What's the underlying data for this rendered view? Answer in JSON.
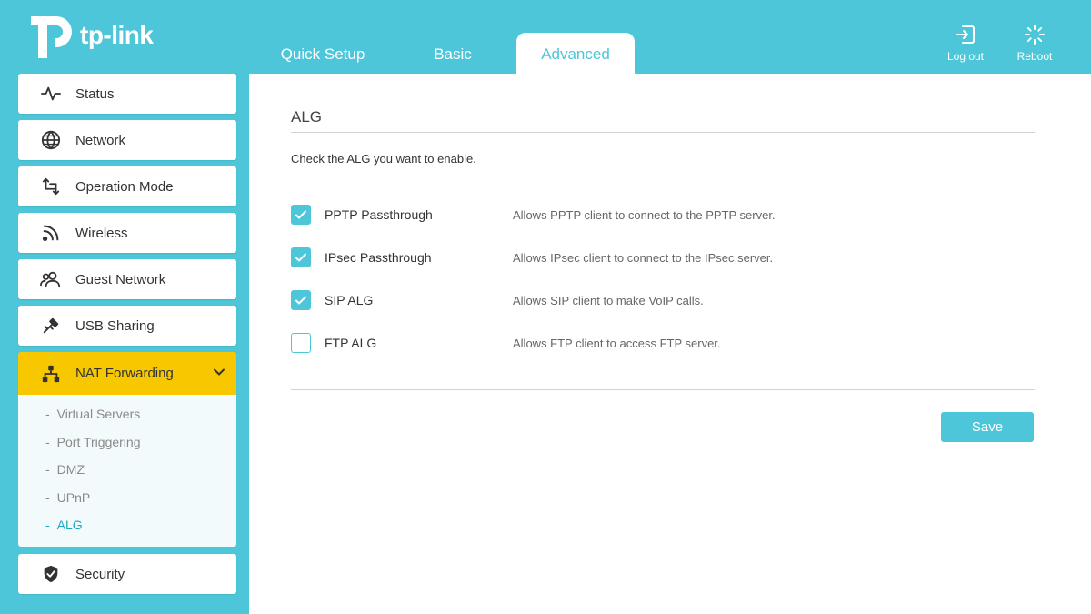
{
  "brand": {
    "name": "tp-link"
  },
  "tabs": [
    {
      "label": "Quick Setup"
    },
    {
      "label": "Basic"
    },
    {
      "label": "Advanced",
      "active": true
    }
  ],
  "top_actions": {
    "logout": {
      "label": "Log out",
      "icon": "logout-icon"
    },
    "reboot": {
      "label": "Reboot",
      "icon": "reboot-icon"
    }
  },
  "sidebar": {
    "items": [
      {
        "label": "Status",
        "icon": "pulse-icon"
      },
      {
        "label": "Network",
        "icon": "globe-icon"
      },
      {
        "label": "Operation Mode",
        "icon": "swap-icon"
      },
      {
        "label": "Wireless",
        "icon": "wifi-icon"
      },
      {
        "label": "Guest Network",
        "icon": "guests-icon"
      },
      {
        "label": "USB Sharing",
        "icon": "usb-icon"
      },
      {
        "label": "NAT Forwarding",
        "icon": "network-tree-icon",
        "active": true,
        "expanded": true
      },
      {
        "label": "Security",
        "icon": "shield-icon"
      }
    ],
    "nat_submenu": [
      {
        "label": "Virtual Servers"
      },
      {
        "label": "Port Triggering"
      },
      {
        "label": "DMZ"
      },
      {
        "label": "UPnP"
      },
      {
        "label": "ALG",
        "active": true
      }
    ]
  },
  "main": {
    "title": "ALG",
    "intro": "Check the ALG you want to enable.",
    "rows": [
      {
        "name": "PPTP Passthrough",
        "checked": true,
        "desc": "Allows PPTP client to connect to the PPTP server."
      },
      {
        "name": "IPsec Passthrough",
        "checked": true,
        "desc": "Allows IPsec client to connect to the IPsec server."
      },
      {
        "name": "SIP ALG",
        "checked": true,
        "desc": "Allows SIP client to make VoIP calls."
      },
      {
        "name": "FTP ALG",
        "checked": false,
        "desc": "Allows FTP client to access FTP server."
      }
    ],
    "save_label": "Save"
  },
  "colors": {
    "brand": "#4cc6d8",
    "active_menu": "#f7c800",
    "active_sub": "#1aa8c0"
  }
}
